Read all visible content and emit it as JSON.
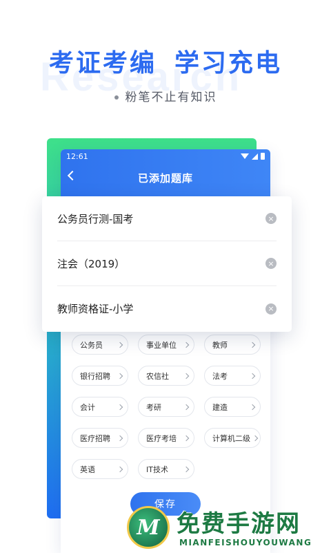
{
  "hero": {
    "headline_left": "考证考编",
    "headline_right": "学习充电",
    "watermark": "Research",
    "tagline": "粉笔不止有知识"
  },
  "phone": {
    "status_time": "12:61",
    "nav_title": "已添加题库",
    "back_icon": "chevron-left-icon"
  },
  "added_banks": [
    {
      "label": "公务员行测-国考"
    },
    {
      "label": "注会（2019）"
    },
    {
      "label": "教师资格证-小学"
    }
  ],
  "remove_icon_glyph": "×",
  "categories": [
    {
      "label": "公务员"
    },
    {
      "label": "事业单位"
    },
    {
      "label": "教师"
    },
    {
      "label": "银行招聘"
    },
    {
      "label": "农信社"
    },
    {
      "label": "法考"
    },
    {
      "label": "会计"
    },
    {
      "label": "考研"
    },
    {
      "label": "建造"
    },
    {
      "label": "医疗招聘"
    },
    {
      "label": "医疗考培"
    },
    {
      "label": "计算机二级"
    },
    {
      "label": "英语"
    },
    {
      "label": "IT技术"
    }
  ],
  "save_label": "保存",
  "brand": {
    "logo_letter": "M",
    "name": "免费手游网",
    "sub": "MIANFEISHOUYOUWANG"
  },
  "colors": {
    "accent": "#2c6bf0",
    "gradient_top": "#3ee08a",
    "gradient_bottom": "#1f6ef2",
    "brand_green": "#1d7a43"
  }
}
